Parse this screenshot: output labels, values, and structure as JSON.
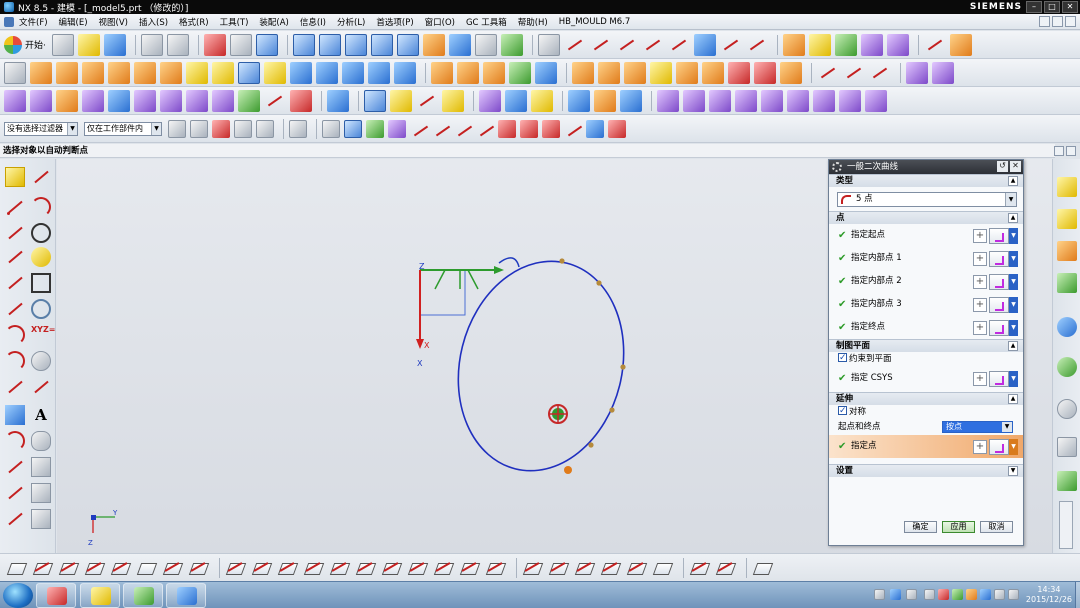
{
  "window": {
    "title": "NX 8.5 - 建模 - [_model5.prt （修改的）]",
    "brand": "SIEMENS",
    "controls": [
      "–",
      "□",
      "✕"
    ]
  },
  "menu": {
    "items": [
      "文件(F)",
      "编辑(E)",
      "视图(V)",
      "插入(S)",
      "格式(R)",
      "工具(T)",
      "装配(A)",
      "信息(I)",
      "分析(L)",
      "首选项(P)",
      "窗口(O)",
      "GC 工具箱",
      "帮助(H)",
      "HB_MOULD M6.7"
    ]
  },
  "toolbar": {
    "start_label": "开始·",
    "filter_type": "没有选择过滤器",
    "filter_scope": "仅在工作部件内"
  },
  "prompt": "选择对象以自动判断点",
  "dialog": {
    "title": "一般二次曲线",
    "type_section": "类型",
    "type_value": "5 点",
    "points_section": "点",
    "points": [
      "指定起点",
      "指定内部点 1",
      "指定内部点 2",
      "指定内部点 3",
      "指定终点"
    ],
    "plane_section": "制图平面",
    "constrain_label": "约束到平面",
    "csys_label": "指定 CSYS",
    "extension_section": "延伸",
    "symmetric_label": "对称",
    "start_end_label": "起点和终点",
    "start_end_value": "按点",
    "specify_point_label": "指定点",
    "settings_section": "设置",
    "ok": "确定",
    "apply": "应用",
    "cancel": "取消"
  },
  "canvas": {
    "wcs_labels": {
      "z": "Z",
      "x_upper": "X",
      "x_lower": "X"
    },
    "mini_axis": {
      "y": "Y",
      "z": "Z"
    }
  },
  "taskbar": {
    "time": "14:34",
    "date": "2015/12/26"
  }
}
